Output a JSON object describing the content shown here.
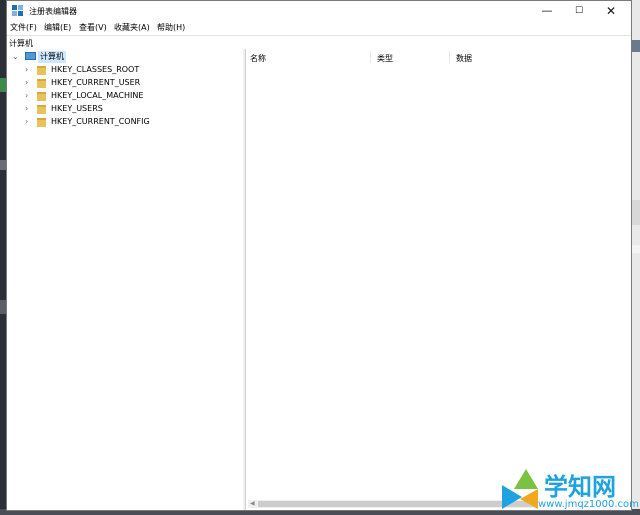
{
  "window": {
    "title": "注册表编辑器"
  },
  "controls": {
    "minimize": "—",
    "maximize": "☐",
    "close": "✕"
  },
  "menu": [
    "文件(F)",
    "编辑(E)",
    "查看(V)",
    "收藏夹(A)",
    "帮助(H)"
  ],
  "address": "计算机",
  "tree": {
    "root": "计算机",
    "keys": [
      "HKEY_CLASSES_ROOT",
      "HKEY_CURRENT_USER",
      "HKEY_LOCAL_MACHINE",
      "HKEY_USERS",
      "HKEY_CURRENT_CONFIG"
    ]
  },
  "columns": [
    "名称",
    "类型",
    "数据"
  ],
  "watermark": {
    "brand": "学知网",
    "url": "www.jmqz1000.com"
  },
  "colors": {
    "selection": "#cce8ff",
    "folder": "#e8c25c",
    "accent": "#1f6fb8"
  }
}
